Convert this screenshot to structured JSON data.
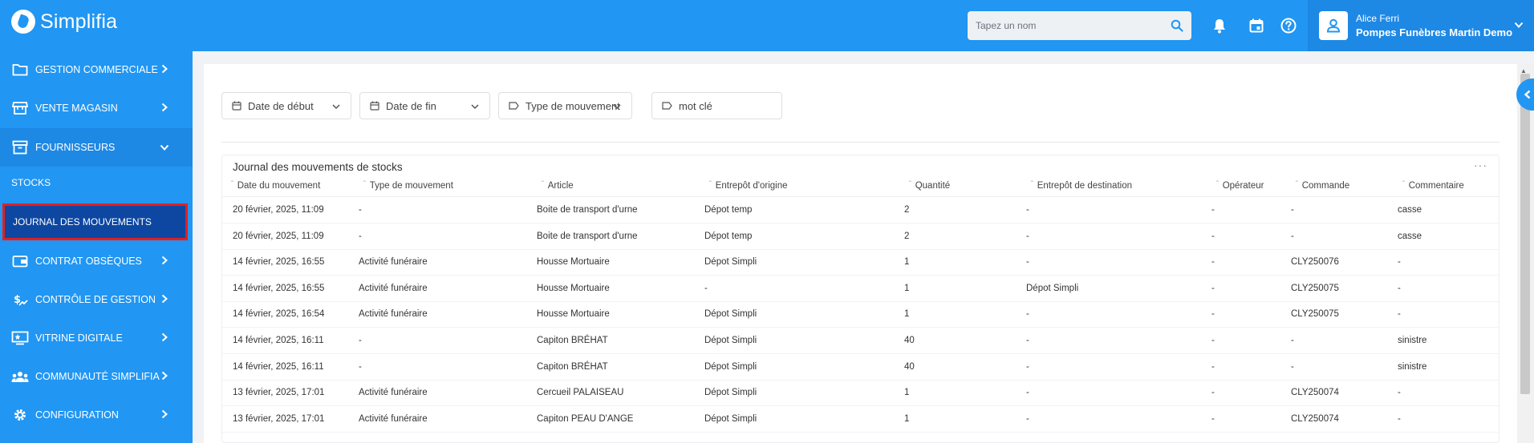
{
  "app": {
    "name": "Simplifia"
  },
  "search": {
    "placeholder": "Tapez un nom"
  },
  "user": {
    "name": "Alice Ferri",
    "company": "Pompes Funèbres Martin Demo"
  },
  "sidebar": {
    "items": [
      {
        "label": "GESTION COMMERCIALE",
        "icon": "folder-icon"
      },
      {
        "label": "VENTE MAGASIN",
        "icon": "store-icon"
      },
      {
        "label": "FOURNISSEURS",
        "icon": "archive-icon"
      },
      {
        "label": "CONTRAT OBSÈQUES",
        "icon": "wallet-icon"
      },
      {
        "label": "CONTRÔLE DE GESTION",
        "icon": "finance-icon"
      },
      {
        "label": "VITRINE DIGITALE",
        "icon": "showcase-icon"
      },
      {
        "label": "COMMUNAUTÉ SIMPLIFIA",
        "icon": "community-icon"
      },
      {
        "label": "CONFIGURATION",
        "icon": "gear-icon"
      }
    ],
    "sub_items": [
      {
        "label": "STOCKS"
      },
      {
        "label": "JOURNAL DES MOUVEMENTS"
      }
    ]
  },
  "filters": {
    "start_date": "Date de début",
    "end_date": "Date de fin",
    "movement_type": "Type de mouvement",
    "keyword": "mot clé"
  },
  "table": {
    "title": "Journal des mouvements de stocks",
    "menu": "···",
    "columns": [
      "Date du mouvement",
      "Type de mouvement",
      "Article",
      "Entrepôt d'origine",
      "Quantité",
      "Entrepôt de destination",
      "Opérateur",
      "Commande",
      "Commentaire"
    ],
    "rows": [
      [
        "20 février, 2025, 11:09",
        "-",
        "Boite de transport d'urne",
        "Dépot temp",
        "2",
        "-",
        "-",
        "-",
        "casse"
      ],
      [
        "20 février, 2025, 11:09",
        "-",
        "Boite de transport d'urne",
        "Dépot temp",
        "2",
        "-",
        "-",
        "-",
        "casse"
      ],
      [
        "14 février, 2025, 16:55",
        "Activité funéraire",
        "Housse Mortuaire",
        "Dépot Simpli",
        "1",
        "-",
        "-",
        "CLY250076",
        "-"
      ],
      [
        "14 février, 2025, 16:55",
        "Activité funéraire",
        "Housse Mortuaire",
        "-",
        "1",
        "Dépot Simpli",
        "-",
        "CLY250075",
        "-"
      ],
      [
        "14 février, 2025, 16:54",
        "Activité funéraire",
        "Housse Mortuaire",
        "Dépot Simpli",
        "1",
        "-",
        "-",
        "CLY250075",
        "-"
      ],
      [
        "14 février, 2025, 16:11",
        "-",
        "Capiton BRÉHAT",
        "Dépot Simpli",
        "40",
        "-",
        "-",
        "-",
        "sinistre"
      ],
      [
        "14 février, 2025, 16:11",
        "-",
        "Capiton BRÉHAT",
        "Dépot Simpli",
        "40",
        "-",
        "-",
        "-",
        "sinistre"
      ],
      [
        "13 février, 2025, 17:01",
        "Activité funéraire",
        "Cercueil PALAISEAU",
        "Dépot Simpli",
        "1",
        "-",
        "-",
        "CLY250074",
        "-"
      ],
      [
        "13 février, 2025, 17:01",
        "Activité funéraire",
        "Capiton PEAU D'ANGE",
        "Dépot Simpli",
        "1",
        "-",
        "-",
        "CLY250074",
        "-"
      ]
    ]
  },
  "colors": {
    "primary": "#2196f3",
    "active_nav": "#0d47a1",
    "highlight_border": "#e02020"
  }
}
